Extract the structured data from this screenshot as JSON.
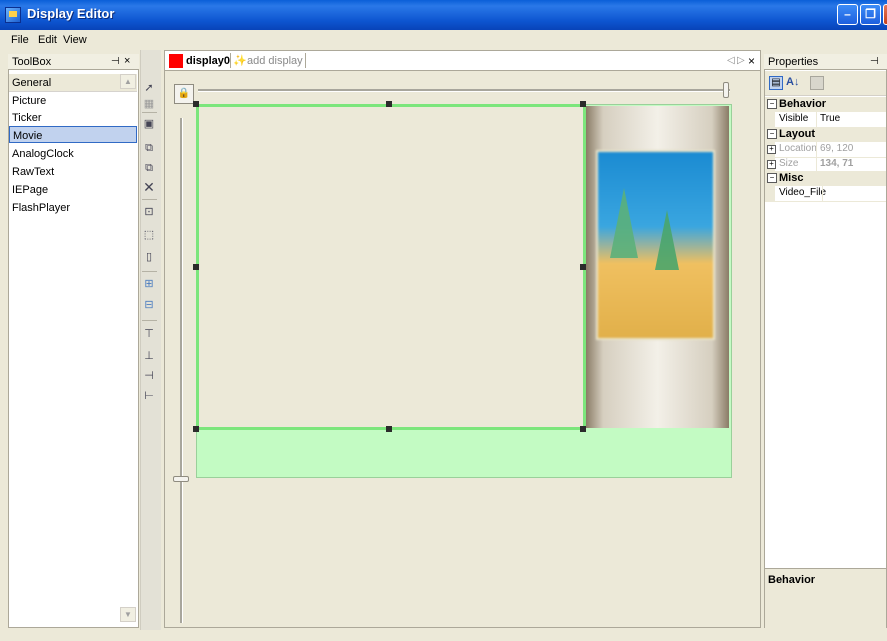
{
  "window": {
    "title": "Display Editor",
    "min": "–",
    "max": "❐",
    "close": "✕"
  },
  "menu": {
    "file": "File",
    "edit": "Edit",
    "view": "View"
  },
  "toolbox": {
    "title": "ToolBox",
    "pin": "⊣",
    "close": "×",
    "group": "General",
    "items": [
      "Picture",
      "Ticker",
      "Movie",
      "AnalogClock",
      "RawText",
      "IEPage",
      "FlashPlayer"
    ],
    "selected": "Movie"
  },
  "document": {
    "tab_label": "display0",
    "add_label": "add display",
    "nav_left": "◁",
    "nav_right": "▷",
    "close": "×"
  },
  "properties": {
    "title": "Properties",
    "pin": "⊣",
    "categories": {
      "behavior": "Behavior",
      "layout": "Layout",
      "misc": "Misc"
    },
    "rows": {
      "visible": {
        "name": "Visible",
        "value": "True"
      },
      "location": {
        "name": "Location",
        "value": "69, 120"
      },
      "size": {
        "name": "Size",
        "value": "134, 71"
      },
      "video_file": {
        "name": "Video_File",
        "value": ""
      }
    },
    "description_title": "Behavior"
  },
  "colors": {
    "accent": "#0a5fd8",
    "selection_border": "#7ce67c",
    "display_bg": "#c3fbc3"
  }
}
